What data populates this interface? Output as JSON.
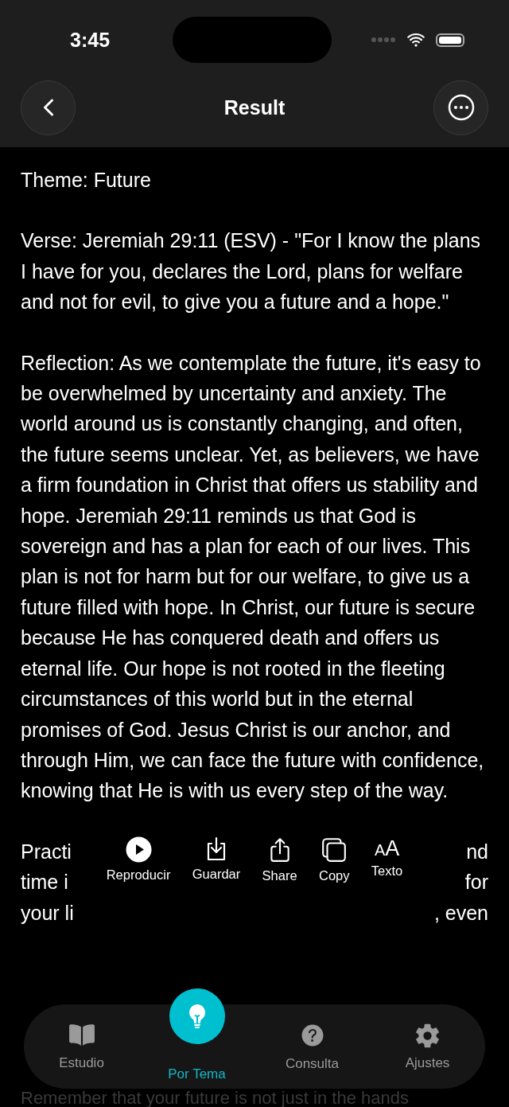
{
  "status_bar": {
    "time": "3:45"
  },
  "header": {
    "title": "Result"
  },
  "paragraphs": [
    "Theme: Future",
    "Verse: Jeremiah 29:11 (ESV) - \"For I know the plans I have for you, declares the Lord, plans for welfare and not for evil, to give you a future and a hope.\"",
    "Reflection: As we contemplate the future, it's easy to be overwhelmed by uncertainty and anxiety. The world around us is constantly changing, and often, the future seems unclear. Yet, as believers, we have a firm foundation in Christ that offers us stability and hope. Jeremiah 29:11 reminds us that God is sovereign and has a plan for each of our lives. This plan is not for harm but for our welfare, to give us a future filled with hope. In Christ, our future is secure because He has conquered death and offers us eternal life. Our hope is not rooted in the fleeting circumstances of this world but in the eternal promises of God. Jesus Christ is our anchor, and through Him, we can face the future with confidence, knowing that He is with us every step of the way."
  ],
  "covered_lines": [
    {
      "left": "Practi",
      "right": "nd"
    },
    {
      "left": "time i",
      "right": "for"
    },
    {
      "left": "your li",
      "right": ", even"
    }
  ],
  "actions": [
    {
      "kind": "play",
      "label": "Reproducir"
    },
    {
      "kind": "save",
      "label": "Guardar"
    },
    {
      "kind": "share",
      "label": "Share"
    },
    {
      "kind": "copy",
      "label": "Copy"
    },
    {
      "kind": "text",
      "glyph": "AA",
      "label": "Texto"
    }
  ],
  "trailing_line": "Remember that your future is not just in the hands",
  "tabs": [
    {
      "kind": "book",
      "label": "Estudio",
      "selected": false
    },
    {
      "kind": "bulb",
      "label": "Por Tema",
      "selected": true
    },
    {
      "kind": "help",
      "label": "Consulta",
      "selected": false
    },
    {
      "kind": "gear",
      "label": "Ajustes",
      "selected": false
    }
  ]
}
